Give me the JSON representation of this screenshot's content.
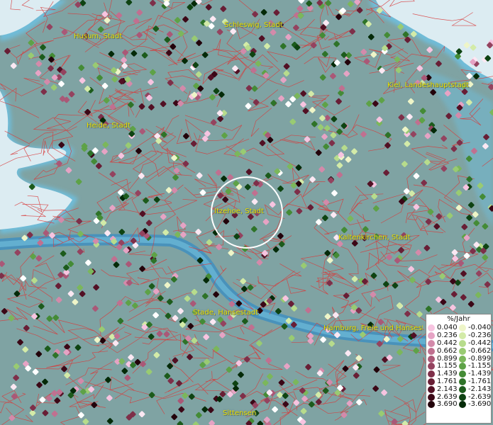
{
  "place_labels": {
    "husum": "Husum, Stadt",
    "schleswig": "Schleswig, Stadt",
    "kiel": "Kiel, Landeshauptstadt",
    "heide": "Heide, Stadt",
    "itzehoe": "Itzehoe, Stadt",
    "kaltenkirchen": "Kaltenkirchen, Stadt",
    "stade": "Stade, Hansestadt",
    "hamburg": "Hamburg, Freie und Hansestadt",
    "sittensen": "Sittensen"
  },
  "legend": {
    "title": "%/Jahr",
    "positive": [
      {
        "label": "0.040",
        "color": "#f7c4e0"
      },
      {
        "label": "0.236",
        "color": "#e6a3c4"
      },
      {
        "label": "0.442",
        "color": "#d38aaa"
      },
      {
        "label": "0.662",
        "color": "#c07090"
      },
      {
        "label": "0.899",
        "color": "#aa5877"
      },
      {
        "label": "1.155",
        "color": "#94435f"
      },
      {
        "label": "1.439",
        "color": "#7e2f49"
      },
      {
        "label": "1.761",
        "color": "#681e35"
      },
      {
        "label": "2.143",
        "color": "#521024"
      },
      {
        "label": "2.639",
        "color": "#3b0716"
      },
      {
        "label": "3.690",
        "color": "#22020a"
      }
    ],
    "negative": [
      {
        "label": "-0.040",
        "color": "#eef5c8"
      },
      {
        "label": "-0.236",
        "color": "#d3eba8"
      },
      {
        "label": "-0.442",
        "color": "#b7dc8c"
      },
      {
        "label": "-0.662",
        "color": "#99cb72"
      },
      {
        "label": "-0.899",
        "color": "#7bb75b"
      },
      {
        "label": "-1.155",
        "color": "#5ea247"
      },
      {
        "label": "-1.439",
        "color": "#448b36"
      },
      {
        "label": "-1.761",
        "color": "#2e7328"
      },
      {
        "label": "-2.143",
        "color": "#1c5b1c"
      },
      {
        "label": "-2.639",
        "color": "#0e4312"
      },
      {
        "label": "-3.690",
        "color": "#042a08"
      }
    ]
  },
  "colors": {
    "land": "#7fa3a3",
    "water": "#d8eaf0",
    "coast": "#6fbcd8",
    "borders": "#d83a3a",
    "label": "#e8e000",
    "selection": "#ffffff"
  }
}
